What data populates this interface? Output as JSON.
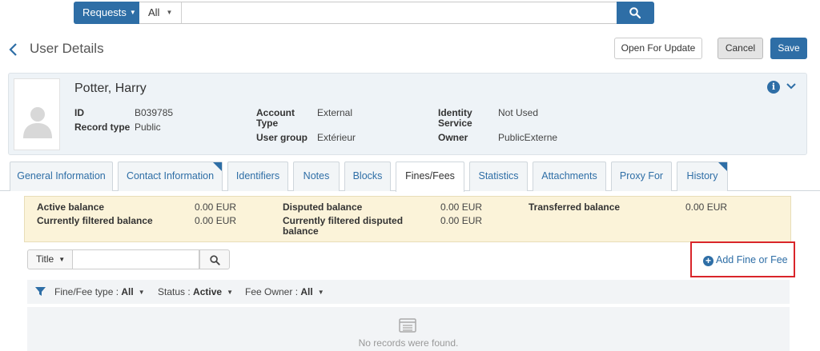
{
  "search": {
    "scope_label": "Requests",
    "filter_value": "All",
    "query": ""
  },
  "header": {
    "title": "User Details",
    "open_for_update": "Open For Update",
    "cancel": "Cancel",
    "save": "Save"
  },
  "user": {
    "name": "Potter, Harry",
    "fields": {
      "id_label": "ID",
      "id_value": "B039785",
      "record_type_label": "Record type",
      "record_type_value": "Public",
      "account_type_label_1": "Account",
      "account_type_label_2": "Type",
      "account_type_value": "External",
      "user_group_label": "User group",
      "user_group_value": "Extérieur",
      "identity_service_label_1": "Identity",
      "identity_service_label_2": "Service",
      "identity_service_value": "Not Used",
      "owner_label": "Owner",
      "owner_value": "PublicExterne"
    }
  },
  "tabs": [
    {
      "label": "General Information",
      "active": false
    },
    {
      "label": "Contact Information",
      "active": false
    },
    {
      "label": "Identifiers",
      "active": false
    },
    {
      "label": "Notes",
      "active": false
    },
    {
      "label": "Blocks",
      "active": false
    },
    {
      "label": "Fines/Fees",
      "active": true
    },
    {
      "label": "Statistics",
      "active": false
    },
    {
      "label": "Attachments",
      "active": false
    },
    {
      "label": "Proxy For",
      "active": false
    },
    {
      "label": "History",
      "active": false
    }
  ],
  "balances": {
    "active_label": "Active balance",
    "active_value": "0.00 EUR",
    "filtered_label": "Currently filtered balance",
    "filtered_value": "0.00 EUR",
    "disputed_label": "Disputed balance",
    "disputed_value": "0.00 EUR",
    "filtered_disputed_label_1": "Currently filtered disputed",
    "filtered_disputed_label_2": "balance",
    "filtered_disputed_value": "0.00 EUR",
    "transferred_label": "Transferred balance",
    "transferred_value": "0.00 EUR"
  },
  "list_search": {
    "field": "Title",
    "query": ""
  },
  "add_fine": "Add Fine or Fee",
  "facets": {
    "type_label": "Fine/Fee type :",
    "type_value": "All",
    "status_label": "Status :",
    "status_value": "Active",
    "owner_label": "Fee Owner :",
    "owner_value": "All"
  },
  "empty_message": "No records were found.",
  "colors": {
    "primary": "#2e6ea6",
    "highlight_border": "#d9252a",
    "balance_bg": "#fbf3d9"
  }
}
